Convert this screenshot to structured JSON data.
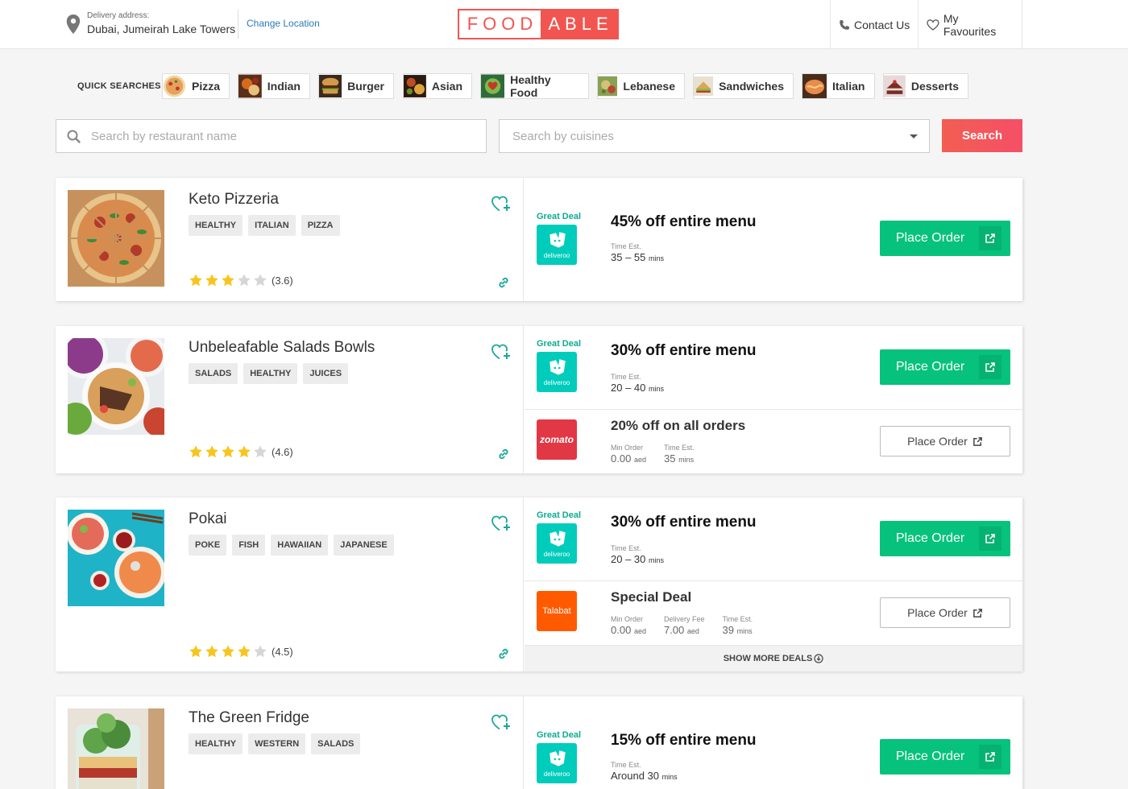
{
  "header": {
    "delivery_label": "Delivery address:",
    "delivery_value": "Dubai, Jumeirah Lake Towers",
    "change_location": "Change Location",
    "logo_left": "FOOD",
    "logo_right": "ABLE",
    "contact": "Contact Us",
    "favourites": "My Favourites"
  },
  "quick": {
    "title": "QUICK SEARCHES:",
    "items": [
      "Pizza",
      "Indian",
      "Burger",
      "Asian",
      "Healthy Food",
      "Lebanese",
      "Sandwiches",
      "Italian",
      "Desserts"
    ]
  },
  "search": {
    "placeholder": "Search by restaurant name",
    "cuisine_placeholder": "Search by cuisines",
    "button": "Search"
  },
  "common": {
    "great_deal": "Great Deal",
    "place_order": "Place Order",
    "time_est": "Time Est.",
    "min_order": "Min Order",
    "delivery_fee": "Delivery Fee",
    "mins": "mins",
    "aed": "aed",
    "deliveroo": "deliveroo",
    "zomato": "zomato",
    "talabat": "Talabat",
    "show_more": "SHOW MORE DEALS"
  },
  "restaurants": [
    {
      "name": "Keto Pizzeria",
      "tags": [
        "HEALTHY",
        "ITALIAN",
        "PIZZA"
      ],
      "rating": 3.6,
      "rating_text": "(3.6)",
      "deals": [
        {
          "title": "45% off entire menu",
          "time": "35 – 55"
        }
      ]
    },
    {
      "name": "Unbeleafable Salads Bowls",
      "tags": [
        "SALADS",
        "HEALTHY",
        "JUICES"
      ],
      "rating": 4.6,
      "rating_text": "(4.6)",
      "deals": [
        {
          "title": "30% off entire menu",
          "time": "20 – 40"
        },
        {
          "title": "20% off on all orders",
          "min_order": "0.00",
          "time": "35"
        }
      ]
    },
    {
      "name": "Pokai",
      "tags": [
        "POKE",
        "FISH",
        "HAWAIIAN",
        "JAPANESE"
      ],
      "rating": 4.5,
      "rating_text": "(4.5)",
      "deals": [
        {
          "title": "30% off entire menu",
          "time": "20 – 30"
        },
        {
          "title": "Special Deal",
          "min_order": "0.00",
          "delivery_fee": "7.00",
          "time": "39"
        }
      ]
    },
    {
      "name": "The Green Fridge",
      "tags": [
        "HEALTHY",
        "WESTERN",
        "SALADS"
      ],
      "deals": [
        {
          "title": "15% off entire menu",
          "time": "Around 30"
        }
      ]
    }
  ]
}
